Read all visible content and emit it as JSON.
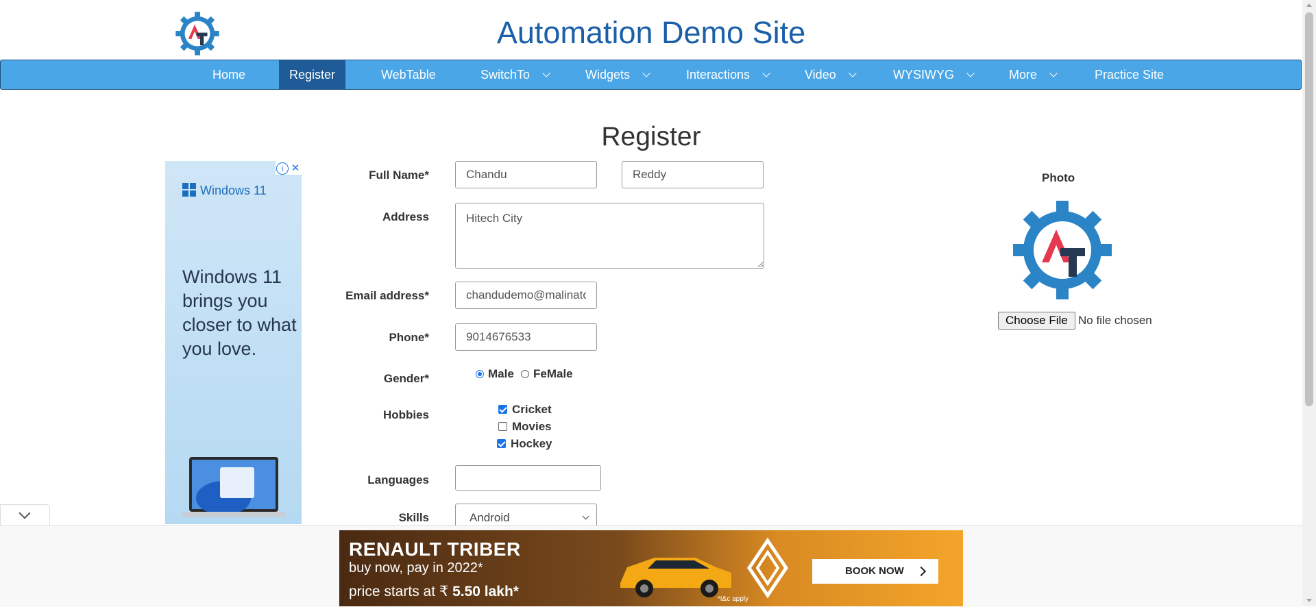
{
  "header": {
    "title": "Automation Demo Site"
  },
  "nav": {
    "items": [
      {
        "label": "Home",
        "dropdown": false,
        "active": false
      },
      {
        "label": "Register",
        "dropdown": false,
        "active": true
      },
      {
        "label": "WebTable",
        "dropdown": false,
        "active": false
      },
      {
        "label": "SwitchTo",
        "dropdown": true,
        "active": false
      },
      {
        "label": "Widgets",
        "dropdown": true,
        "active": false
      },
      {
        "label": "Interactions",
        "dropdown": true,
        "active": false
      },
      {
        "label": "Video",
        "dropdown": true,
        "active": false
      },
      {
        "label": "WYSIWYG",
        "dropdown": true,
        "active": false
      },
      {
        "label": "More",
        "dropdown": true,
        "active": false
      },
      {
        "label": "Practice Site",
        "dropdown": false,
        "active": false
      }
    ]
  },
  "page": {
    "heading": "Register"
  },
  "form": {
    "full_name_label": "Full Name*",
    "first_name": "Chandu",
    "last_name": "Reddy",
    "address_label": "Address",
    "address": "Hitech City",
    "email_label": "Email address*",
    "email": "chandudemo@malinator.com",
    "phone_label": "Phone*",
    "phone": "9014676533",
    "gender_label": "Gender*",
    "gender_options": [
      "Male",
      "FeMale"
    ],
    "gender_selected": "Male",
    "hobbies_label": "Hobbies",
    "hobbies": [
      {
        "label": "Cricket",
        "checked": true
      },
      {
        "label": "Movies",
        "checked": false
      },
      {
        "label": "Hockey",
        "checked": true
      }
    ],
    "languages_label": "Languages",
    "languages": "",
    "skills_label": "Skills",
    "skills_selected": "Android"
  },
  "photo": {
    "label": "Photo",
    "choose_button": "Choose File",
    "status": "No file chosen"
  },
  "side_ad": {
    "brand": "Windows 11",
    "text": "Windows 11 brings you closer to what you love.",
    "info_icon": "i",
    "close_icon": "✕"
  },
  "bottom_ad": {
    "title": "RENAULT TRIBER",
    "subtitle": "buy now, pay in 2022*",
    "price_prefix": "price starts at ₹ ",
    "price": "5.50 lakh*",
    "cta": "BOOK NOW",
    "tc": "*t&c apply"
  },
  "colors": {
    "title_blue": "#1a5fa8",
    "nav_bg": "#4aa6e6",
    "nav_active": "#1f5b97",
    "logo_red": "#e5384e",
    "logo_blue": "#2a84c6",
    "logo_dark": "#253a52"
  }
}
